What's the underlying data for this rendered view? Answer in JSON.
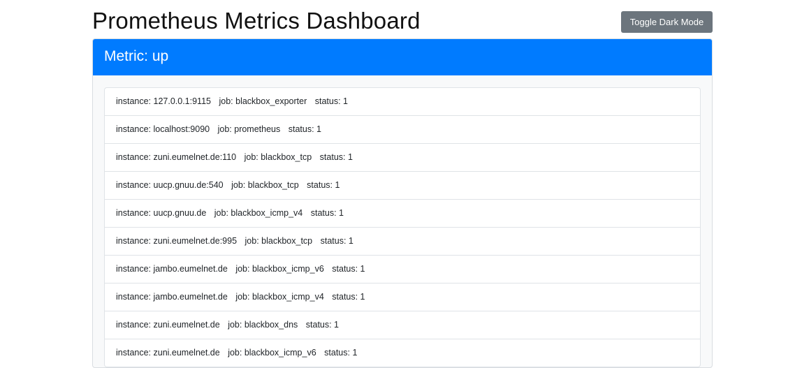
{
  "header": {
    "title": "Prometheus Metrics Dashboard",
    "toggle_label": "Toggle Dark Mode"
  },
  "metric": {
    "heading": "Metric: up",
    "items": [
      {
        "instance": "instance: 127.0.0.1:9115",
        "job": "job: blackbox_exporter",
        "status": "status: 1"
      },
      {
        "instance": "instance: localhost:9090",
        "job": "job: prometheus",
        "status": "status: 1"
      },
      {
        "instance": "instance: zuni.eumelnet.de:110",
        "job": "job: blackbox_tcp",
        "status": "status: 1"
      },
      {
        "instance": "instance: uucp.gnuu.de:540",
        "job": "job: blackbox_tcp",
        "status": "status: 1"
      },
      {
        "instance": "instance: uucp.gnuu.de",
        "job": "job: blackbox_icmp_v4",
        "status": "status: 1"
      },
      {
        "instance": "instance: zuni.eumelnet.de:995",
        "job": "job: blackbox_tcp",
        "status": "status: 1"
      },
      {
        "instance": "instance: jambo.eumelnet.de",
        "job": "job: blackbox_icmp_v6",
        "status": "status: 1"
      },
      {
        "instance": "instance: jambo.eumelnet.de",
        "job": "job: blackbox_icmp_v4",
        "status": "status: 1"
      },
      {
        "instance": "instance: zuni.eumelnet.de",
        "job": "job: blackbox_dns",
        "status": "status: 1"
      },
      {
        "instance": "instance: zuni.eumelnet.de",
        "job": "job: blackbox_icmp_v6",
        "status": "status: 1"
      }
    ]
  },
  "colors": {
    "primary": "#007bff",
    "secondary_button": "#6c757d"
  }
}
